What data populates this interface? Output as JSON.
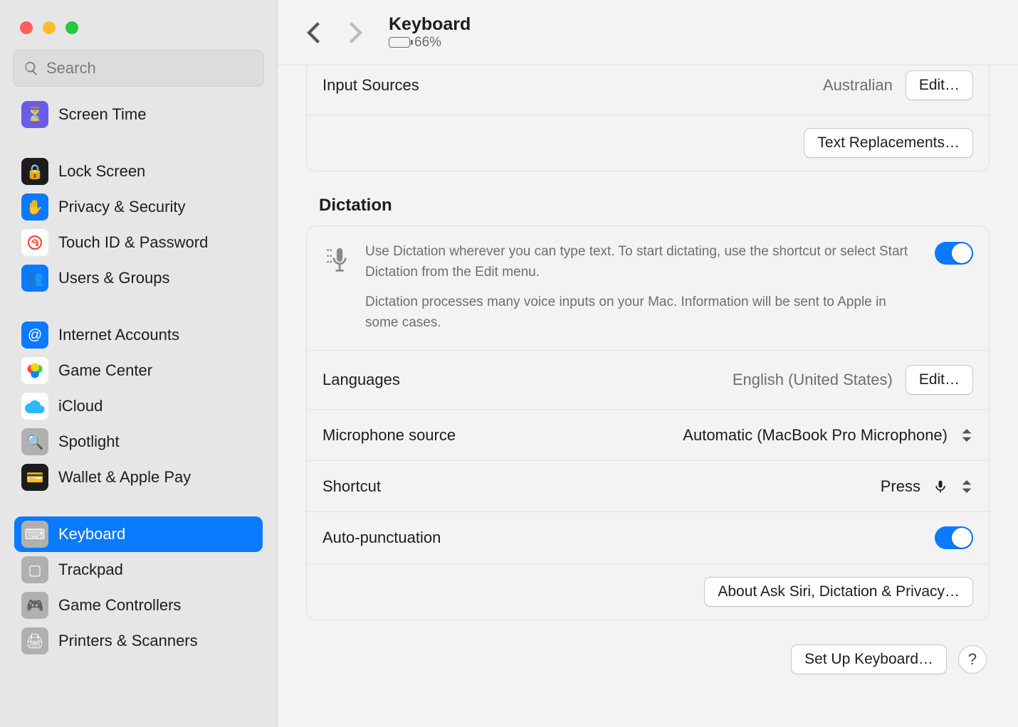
{
  "header": {
    "title": "Keyboard",
    "battery_percent": "66%"
  },
  "search": {
    "placeholder": "Search"
  },
  "sidebar": {
    "items": [
      {
        "label": "Screen Time",
        "color": "#6b5ce7"
      },
      {
        "gap": true
      },
      {
        "label": "Lock Screen",
        "color": "#1c1c1e"
      },
      {
        "label": "Privacy & Security",
        "color": "#0a7aff"
      },
      {
        "label": "Touch ID & Password",
        "color": "#ffffff"
      },
      {
        "label": "Users & Groups",
        "color": "#0a7aff"
      },
      {
        "gap": true
      },
      {
        "label": "Internet Accounts",
        "color": "#0a7aff"
      },
      {
        "label": "Game Center",
        "color": "#ffffff"
      },
      {
        "label": "iCloud",
        "color": "#ffffff"
      },
      {
        "label": "Spotlight",
        "color": "#b0b0b0"
      },
      {
        "label": "Wallet & Apple Pay",
        "color": "#1c1c1e"
      },
      {
        "gap": true
      },
      {
        "label": "Keyboard",
        "color": "#b0b0b0",
        "selected": true
      },
      {
        "label": "Trackpad",
        "color": "#b0b0b0"
      },
      {
        "label": "Game Controllers",
        "color": "#b0b0b0"
      },
      {
        "label": "Printers & Scanners",
        "color": "#b0b0b0"
      }
    ]
  },
  "input_sources": {
    "label": "Input Sources",
    "value": "Australian",
    "edit": "Edit…",
    "text_replacements": "Text Replacements…"
  },
  "dictation": {
    "section_title": "Dictation",
    "desc1": "Use Dictation wherever you can type text. To start dictating, use the shortcut or select Start Dictation from the Edit menu.",
    "desc2": "Dictation processes many voice inputs on your Mac. Information will be sent to Apple in some cases.",
    "languages_label": "Languages",
    "languages_value": "English (United States)",
    "edit": "Edit…",
    "mic_label": "Microphone source",
    "mic_value": "Automatic (MacBook Pro Microphone)",
    "shortcut_label": "Shortcut",
    "shortcut_value": "Press",
    "auto_punct_label": "Auto-punctuation",
    "about_button": "About Ask Siri, Dictation & Privacy…"
  },
  "footer": {
    "setup": "Set Up Keyboard…",
    "help": "?"
  }
}
